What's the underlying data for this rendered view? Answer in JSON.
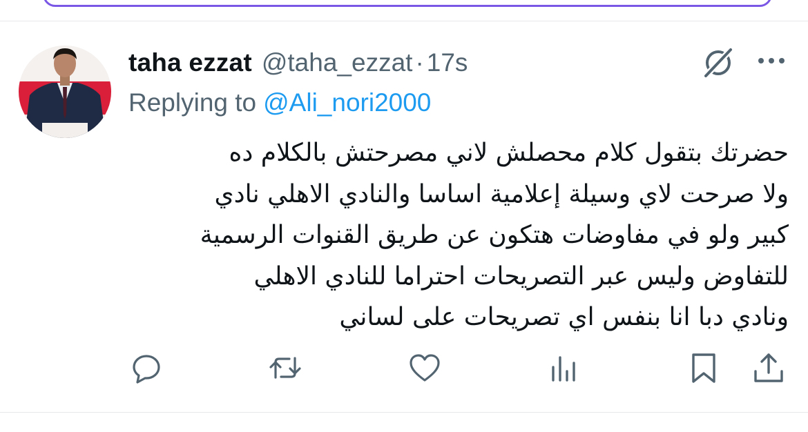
{
  "tweet": {
    "display_name": "taha ezzat",
    "handle": "@taha_ezzat",
    "separator": "·",
    "time": "17s",
    "reply_prefix": "Replying to",
    "reply_to": "@Ali_nori2000",
    "body_lines": [
      "حضرتك بتقول كلام محصلش لاني مصرحتش بالكلام ده",
      "ولا صرحت لاي وسيلة إعلامية اساسا والنادي الاهلي نادي",
      "كبير ولو في مفاوضات هتكون عن طريق القنوات الرسمية",
      "للتفاوض وليس عبر التصريحات احتراما للنادي الاهلي",
      "ونادي دبا انا بنفس اي تصريحات على لساني"
    ]
  },
  "icons": {
    "top_right": [
      "grok-icon",
      "more-icon"
    ],
    "actions": [
      "reply-icon",
      "retweet-icon",
      "like-icon",
      "views-icon",
      "bookmark-icon",
      "share-icon"
    ]
  },
  "colors": {
    "text_primary": "#0f1419",
    "text_secondary": "#536471",
    "accent_blue": "#1d9bf0",
    "top_pill_border": "#7b57e6",
    "divider": "#e6e8ea"
  }
}
